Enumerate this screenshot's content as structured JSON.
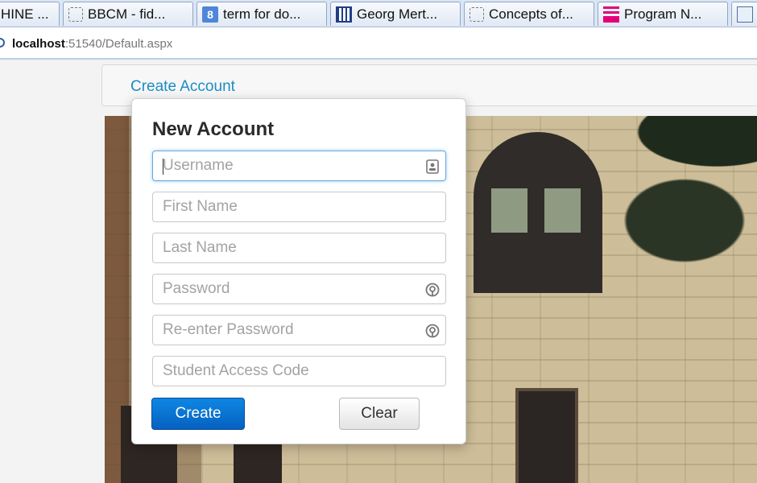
{
  "browser": {
    "tabs": [
      {
        "label": "HINE ...",
        "icon": "none"
      },
      {
        "label": "BBCM - fid...",
        "icon": "dashed-page-icon"
      },
      {
        "label": "term for do...",
        "icon": "google-search-icon"
      },
      {
        "label": "Georg Mert...",
        "icon": "grid-icon"
      },
      {
        "label": "Concepts of...",
        "icon": "dashed-page-icon"
      },
      {
        "label": "Program N...",
        "icon": "program-icon"
      },
      {
        "label": "",
        "icon": "site-icon"
      }
    ],
    "address": {
      "host": "localhost",
      "rest": ":51540/Default.aspx"
    }
  },
  "nav": {
    "create_account": "Create Account"
  },
  "modal": {
    "title": "New Account",
    "fields": {
      "username": {
        "placeholder": "Username",
        "value": ""
      },
      "first_name": {
        "placeholder": "First Name",
        "value": ""
      },
      "last_name": {
        "placeholder": "Last Name",
        "value": ""
      },
      "password": {
        "placeholder": "Password",
        "value": ""
      },
      "reenter_password": {
        "placeholder": "Re-enter Password",
        "value": ""
      },
      "access_code": {
        "placeholder": "Student Access Code",
        "value": ""
      }
    },
    "buttons": {
      "create": "Create",
      "clear": "Clear"
    }
  },
  "colors": {
    "link": "#1b8dc4",
    "primary_button": "#0a6fd2",
    "focus_border": "#6ba7dc"
  }
}
